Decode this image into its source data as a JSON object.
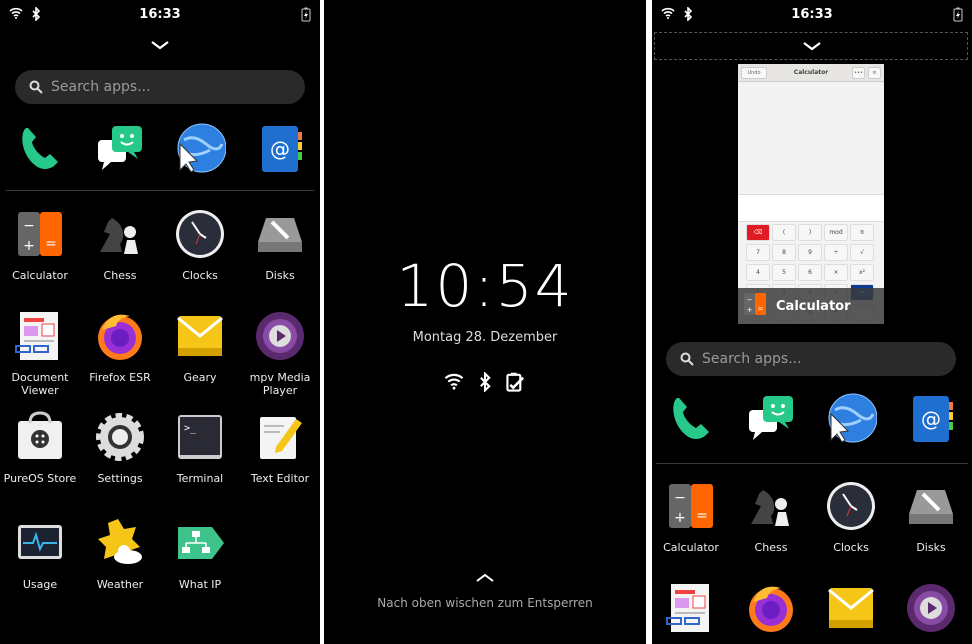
{
  "left_screen": {
    "status": {
      "time": "16:33",
      "icons": [
        "wifi-icon",
        "bluetooth-icon",
        "battery-charging-icon"
      ]
    },
    "search": {
      "placeholder": "Search apps..."
    },
    "favorites": [
      "phone",
      "chat",
      "web",
      "contacts"
    ],
    "apps": [
      {
        "label": "Calculator",
        "icon": "calculator"
      },
      {
        "label": "Chess",
        "icon": "chess"
      },
      {
        "label": "Clocks",
        "icon": "clock"
      },
      {
        "label": "Disks",
        "icon": "disks"
      },
      {
        "label": "Document Viewer",
        "icon": "document"
      },
      {
        "label": "Firefox ESR",
        "icon": "firefox"
      },
      {
        "label": "Geary",
        "icon": "geary"
      },
      {
        "label": "mpv Media Player",
        "icon": "mpv"
      },
      {
        "label": "PureOS Store",
        "icon": "store"
      },
      {
        "label": "Settings",
        "icon": "settings"
      },
      {
        "label": "Terminal",
        "icon": "terminal"
      },
      {
        "label": "Text Editor",
        "icon": "texteditor"
      },
      {
        "label": "Usage",
        "icon": "usage"
      },
      {
        "label": "Weather",
        "icon": "weather"
      },
      {
        "label": "What IP",
        "icon": "whatip"
      }
    ]
  },
  "lock_screen": {
    "time": "10:54",
    "date": "Montag 28. Dezember",
    "icons": [
      "wifi-icon",
      "bluetooth-icon",
      "battery-icon"
    ],
    "hint": "Nach oben wischen zum Entsperren"
  },
  "right_screen": {
    "status": {
      "time": "16:33"
    },
    "running_app": {
      "title": "Calculator",
      "header_title": "Calculator",
      "undo": "Undo",
      "keys": [
        "⌫",
        "(",
        ")",
        "mod",
        "π",
        "7",
        "8",
        "9",
        "÷",
        "√",
        "4",
        "5",
        "6",
        "×",
        "x²",
        "1",
        "2",
        "3",
        "−",
        "=",
        "0",
        ".",
        "%",
        "+",
        ""
      ]
    },
    "search": {
      "placeholder": "Search apps..."
    },
    "apps": [
      {
        "label": "Calculator",
        "icon": "calculator"
      },
      {
        "label": "Chess",
        "icon": "chess"
      },
      {
        "label": "Clocks",
        "icon": "clock"
      },
      {
        "label": "Disks",
        "icon": "disks"
      },
      {
        "label": "",
        "icon": "document"
      },
      {
        "label": "",
        "icon": "firefox"
      },
      {
        "label": "",
        "icon": "geary"
      },
      {
        "label": "",
        "icon": "mpv"
      }
    ]
  }
}
